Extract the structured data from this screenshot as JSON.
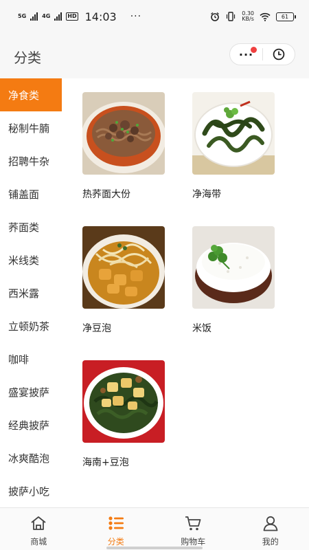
{
  "status_bar": {
    "net1": "5G",
    "net2": "4G",
    "hd": "HD",
    "time": "14:03",
    "dots": "···",
    "speed_value": "0.30",
    "speed_unit": "KB/s",
    "battery": "61"
  },
  "header": {
    "title": "分类",
    "more_label": "···"
  },
  "sidebar": {
    "items": [
      {
        "label": "净食类"
      },
      {
        "label": "秘制牛腩"
      },
      {
        "label": "招聘牛杂"
      },
      {
        "label": "铺盖面"
      },
      {
        "label": "荞面类"
      },
      {
        "label": "米线类"
      },
      {
        "label": "西米露"
      },
      {
        "label": "立顿奶茶"
      },
      {
        "label": "咖啡"
      },
      {
        "label": "盛宴披萨"
      },
      {
        "label": "经典披萨"
      },
      {
        "label": "冰爽酷泡"
      },
      {
        "label": "披萨小吃"
      }
    ],
    "active_index": 0
  },
  "products": [
    {
      "name": "热荞面大份",
      "image": "noodle-bowl"
    },
    {
      "name": "净海带",
      "image": "kelp-dish"
    },
    {
      "name": "净豆泡",
      "image": "tofu-puff-dish"
    },
    {
      "name": "米饭",
      "image": "rice-bowl"
    },
    {
      "name": "海南+豆泡",
      "image": "greens-tofu-dish"
    }
  ],
  "tabbar": {
    "tabs": [
      {
        "label": "商城",
        "icon": "home-icon"
      },
      {
        "label": "分类",
        "icon": "category-icon"
      },
      {
        "label": "购物车",
        "icon": "cart-icon"
      },
      {
        "label": "我的",
        "icon": "user-icon"
      }
    ],
    "active_index": 1
  },
  "colors": {
    "accent": "#f47b12",
    "badge": "#f04040"
  }
}
